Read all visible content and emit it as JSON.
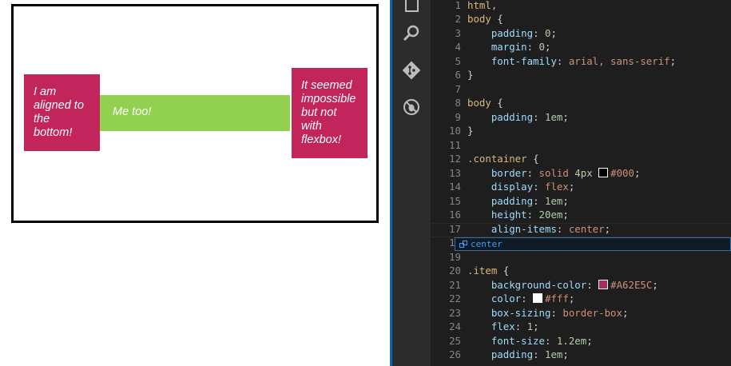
{
  "preview": {
    "items": [
      {
        "text": "I am aligned to the bottom!"
      },
      {
        "text": "Me too!"
      },
      {
        "text": "It seemed impossible but not with flexbox!"
      }
    ],
    "colors": {
      "item": "#c2255c",
      "middle": "#92d050",
      "border": "#000000"
    }
  },
  "activity_bar": {
    "icons": [
      "files-icon",
      "search-icon",
      "git-icon",
      "debug-icon"
    ]
  },
  "editor": {
    "lines": [
      {
        "n": "1",
        "parts": [
          {
            "c": "sel",
            "t": "html,"
          }
        ]
      },
      {
        "n": "2",
        "parts": [
          {
            "c": "sel",
            "t": "body"
          },
          {
            "c": "pun",
            "t": " {"
          }
        ]
      },
      {
        "n": "3",
        "parts": [
          {
            "c": "pun",
            "t": "    "
          },
          {
            "c": "prop",
            "t": "padding"
          },
          {
            "c": "pun",
            "t": ": "
          },
          {
            "c": "num",
            "t": "0"
          },
          {
            "c": "pun",
            "t": ";"
          }
        ]
      },
      {
        "n": "4",
        "parts": [
          {
            "c": "pun",
            "t": "    "
          },
          {
            "c": "prop",
            "t": "margin"
          },
          {
            "c": "pun",
            "t": ": "
          },
          {
            "c": "num",
            "t": "0"
          },
          {
            "c": "pun",
            "t": ";"
          }
        ]
      },
      {
        "n": "5",
        "parts": [
          {
            "c": "pun",
            "t": "    "
          },
          {
            "c": "prop",
            "t": "font-family"
          },
          {
            "c": "pun",
            "t": ": "
          },
          {
            "c": "val",
            "t": "arial, sans-serif"
          },
          {
            "c": "pun",
            "t": ";"
          }
        ]
      },
      {
        "n": "6",
        "parts": [
          {
            "c": "pun",
            "t": "}"
          }
        ]
      },
      {
        "n": "7",
        "parts": []
      },
      {
        "n": "8",
        "parts": [
          {
            "c": "sel",
            "t": "body"
          },
          {
            "c": "pun",
            "t": " {"
          }
        ]
      },
      {
        "n": "9",
        "parts": [
          {
            "c": "pun",
            "t": "    "
          },
          {
            "c": "prop",
            "t": "padding"
          },
          {
            "c": "pun",
            "t": ": "
          },
          {
            "c": "num",
            "t": "1em"
          },
          {
            "c": "pun",
            "t": ";"
          }
        ]
      },
      {
        "n": "10",
        "parts": [
          {
            "c": "pun",
            "t": "}"
          }
        ]
      },
      {
        "n": "11",
        "parts": []
      },
      {
        "n": "12",
        "parts": [
          {
            "c": "sel",
            "t": ".container"
          },
          {
            "c": "pun",
            "t": " {"
          }
        ]
      },
      {
        "n": "13",
        "parts": [
          {
            "c": "pun",
            "t": "    "
          },
          {
            "c": "prop",
            "t": "border"
          },
          {
            "c": "pun",
            "t": ": "
          },
          {
            "c": "val",
            "t": "solid "
          },
          {
            "c": "num",
            "t": "4px "
          },
          {
            "c": "swatch",
            "t": "#000000"
          },
          {
            "c": "val",
            "t": "#000"
          },
          {
            "c": "pun",
            "t": ";"
          }
        ]
      },
      {
        "n": "14",
        "parts": [
          {
            "c": "pun",
            "t": "    "
          },
          {
            "c": "prop",
            "t": "display"
          },
          {
            "c": "pun",
            "t": ": "
          },
          {
            "c": "val",
            "t": "flex"
          },
          {
            "c": "pun",
            "t": ";"
          }
        ]
      },
      {
        "n": "15",
        "parts": [
          {
            "c": "pun",
            "t": "    "
          },
          {
            "c": "prop",
            "t": "padding"
          },
          {
            "c": "pun",
            "t": ": "
          },
          {
            "c": "num",
            "t": "1em"
          },
          {
            "c": "pun",
            "t": ";"
          }
        ]
      },
      {
        "n": "16",
        "parts": [
          {
            "c": "pun",
            "t": "    "
          },
          {
            "c": "prop",
            "t": "height"
          },
          {
            "c": "pun",
            "t": ": "
          },
          {
            "c": "num",
            "t": "20em"
          },
          {
            "c": "pun",
            "t": ";"
          }
        ]
      },
      {
        "n": "17",
        "parts": [
          {
            "c": "pun",
            "t": "    "
          },
          {
            "c": "prop",
            "t": "align-items"
          },
          {
            "c": "pun",
            "t": ": "
          },
          {
            "c": "val",
            "t": "center"
          },
          {
            "c": "pun",
            "t": ";"
          }
        ]
      },
      {
        "n": "18",
        "parts": []
      },
      {
        "n": "19",
        "parts": []
      },
      {
        "n": "20",
        "parts": [
          {
            "c": "sel",
            "t": ".item"
          },
          {
            "c": "pun",
            "t": " {"
          }
        ]
      },
      {
        "n": "21",
        "parts": [
          {
            "c": "pun",
            "t": "    "
          },
          {
            "c": "prop",
            "t": "background-color"
          },
          {
            "c": "pun",
            "t": ": "
          },
          {
            "c": "swatch",
            "t": "#A62E5C"
          },
          {
            "c": "val",
            "t": "#A62E5C"
          },
          {
            "c": "pun",
            "t": ";"
          }
        ]
      },
      {
        "n": "22",
        "parts": [
          {
            "c": "pun",
            "t": "    "
          },
          {
            "c": "prop",
            "t": "color"
          },
          {
            "c": "pun",
            "t": ": "
          },
          {
            "c": "swatch",
            "t": "#ffffff"
          },
          {
            "c": "val",
            "t": "#fff"
          },
          {
            "c": "pun",
            "t": ";"
          }
        ]
      },
      {
        "n": "23",
        "parts": [
          {
            "c": "pun",
            "t": "    "
          },
          {
            "c": "prop",
            "t": "box-sizing"
          },
          {
            "c": "pun",
            "t": ": "
          },
          {
            "c": "val",
            "t": "border-box"
          },
          {
            "c": "pun",
            "t": ";"
          }
        ]
      },
      {
        "n": "24",
        "parts": [
          {
            "c": "pun",
            "t": "    "
          },
          {
            "c": "prop",
            "t": "flex"
          },
          {
            "c": "pun",
            "t": ": "
          },
          {
            "c": "num",
            "t": "1"
          },
          {
            "c": "pun",
            "t": ";"
          }
        ]
      },
      {
        "n": "25",
        "parts": [
          {
            "c": "pun",
            "t": "    "
          },
          {
            "c": "prop",
            "t": "font-size"
          },
          {
            "c": "pun",
            "t": ": "
          },
          {
            "c": "num",
            "t": "1.2em"
          },
          {
            "c": "pun",
            "t": ";"
          }
        ]
      },
      {
        "n": "26",
        "parts": [
          {
            "c": "pun",
            "t": "    "
          },
          {
            "c": "prop",
            "t": "padding"
          },
          {
            "c": "pun",
            "t": ": "
          },
          {
            "c": "num",
            "t": "1em"
          },
          {
            "c": "pun",
            "t": ";"
          }
        ]
      }
    ],
    "suggestion": {
      "label": "center"
    },
    "colors": {
      "background": "#1e1e1e",
      "selector": "#d7ba7d",
      "property": "#9cdcfe",
      "value": "#ce9178"
    }
  }
}
